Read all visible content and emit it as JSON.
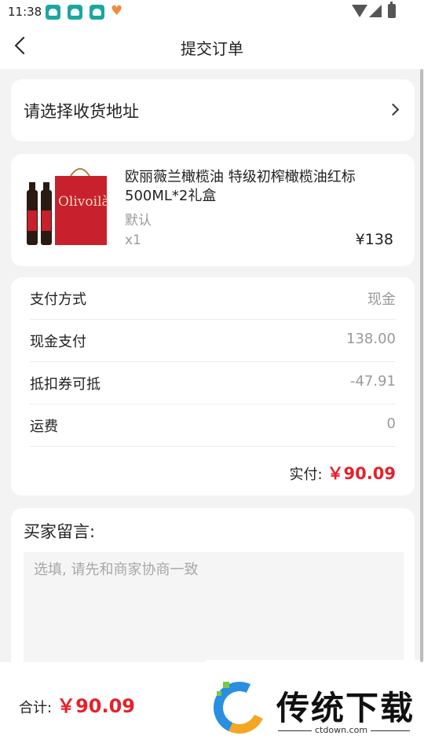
{
  "status_bar": {
    "time": "11:38"
  },
  "header": {
    "title": "提交订单"
  },
  "address": {
    "prompt": "请选择收货地址"
  },
  "product": {
    "name": "欧丽薇兰橄榄油 特级初榨橄榄油红标500ML*2礼盒",
    "spec": "默认",
    "qty": "x1",
    "price": "¥138",
    "image_text": "Olivoilà"
  },
  "payment": {
    "rows": [
      {
        "label": "支付方式",
        "value": "现金"
      },
      {
        "label": "现金支付",
        "value": "138.00"
      },
      {
        "label": "抵扣券可抵",
        "value": "-47.91"
      },
      {
        "label": "运费",
        "value": "0"
      }
    ],
    "actual_label": "实付:",
    "actual_amount": "￥90.09"
  },
  "message": {
    "label": "买家留言:",
    "placeholder": "选填, 请先和商家协商一致"
  },
  "footer": {
    "total_label": "合计:",
    "total_amount": "￥90.09"
  },
  "watermark": {
    "brand": "传统下载",
    "url": "ctdown.com"
  },
  "colors": {
    "accent": "#e8202a",
    "background": "#f3f3f3"
  }
}
